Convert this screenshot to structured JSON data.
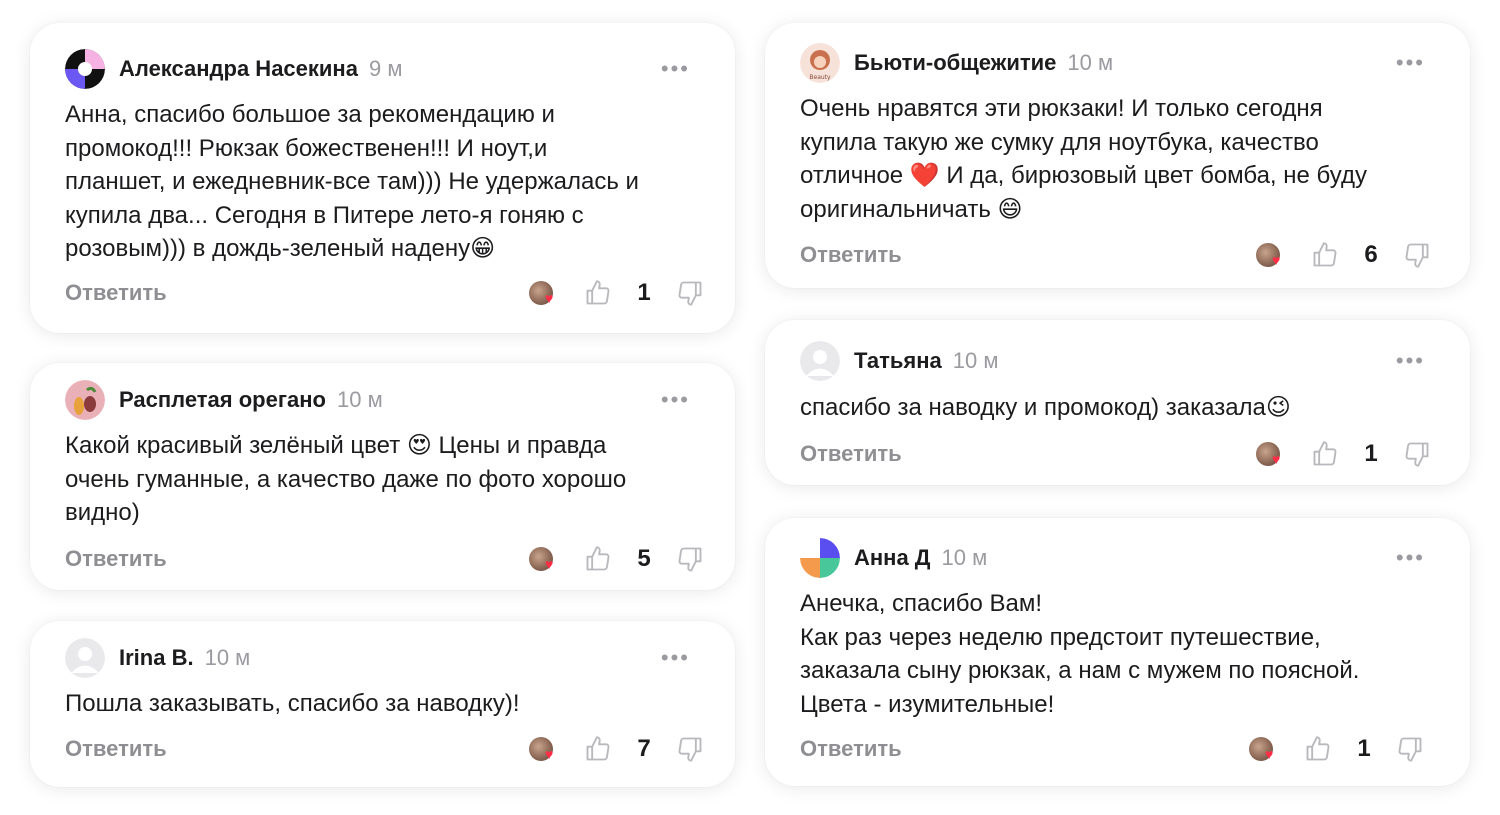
{
  "comments": [
    {
      "name": "Александра Насекина",
      "time": "9 м",
      "text": "Анна, спасибо большое за рекомендацию и\nпромокод!!! Рюкзак божественен!!! И ноут,и\nпланшет, и ежедневник-все там))) Не удержалась и\nкупила два... Сегодня в Питере лето-я гоняю с\nрозовым))) в дождь-зеленый надену😁",
      "reply_label": "Ответить",
      "likes": "1"
    },
    {
      "name": "Расплетая орегано",
      "time": "10 м",
      "text": "Какой красивый зелёный цвет 😍 Цены и правда\nочень гуманные, а качество даже по фото хорошо\nвидно)",
      "reply_label": "Ответить",
      "likes": "5"
    },
    {
      "name": "Irina B.",
      "time": "10 м",
      "text": "Пошла заказывать, спасибо за наводку)!",
      "reply_label": "Ответить",
      "likes": "7"
    },
    {
      "name": "Бьюти-общежитие",
      "time": "10 м",
      "text": "Очень нравятся эти рюкзаки! И только сегодня\nкупила такую же сумку для ноутбука, качество\nотличное ❤️ И да, бирюзовый цвет бомба, не буду\nоригинальничать 😄",
      "reply_label": "Ответить",
      "likes": "6"
    },
    {
      "name": "Татьяна",
      "time": "10 м",
      "text": "спасибо за наводку и промокод) заказала😉",
      "reply_label": "Ответить",
      "likes": "1"
    },
    {
      "name": "Анна Д",
      "time": "10 м",
      "text": "Анечка, спасибо Вам!\nКак раз через неделю предстоит путешествие,\nзаказала сыну рюкзак, а нам с мужем по поясной.\nЦвета - изумительные!",
      "reply_label": "Ответить",
      "likes": "1"
    }
  ],
  "icons": {
    "more": "more-dots-icon",
    "like": "thumbs-up-icon",
    "dislike": "thumbs-down-icon",
    "reaction": "heart-icon"
  },
  "colors": {
    "muted": "#8e8e93",
    "heart": "#ff2d45",
    "text": "#1c1c1e"
  }
}
